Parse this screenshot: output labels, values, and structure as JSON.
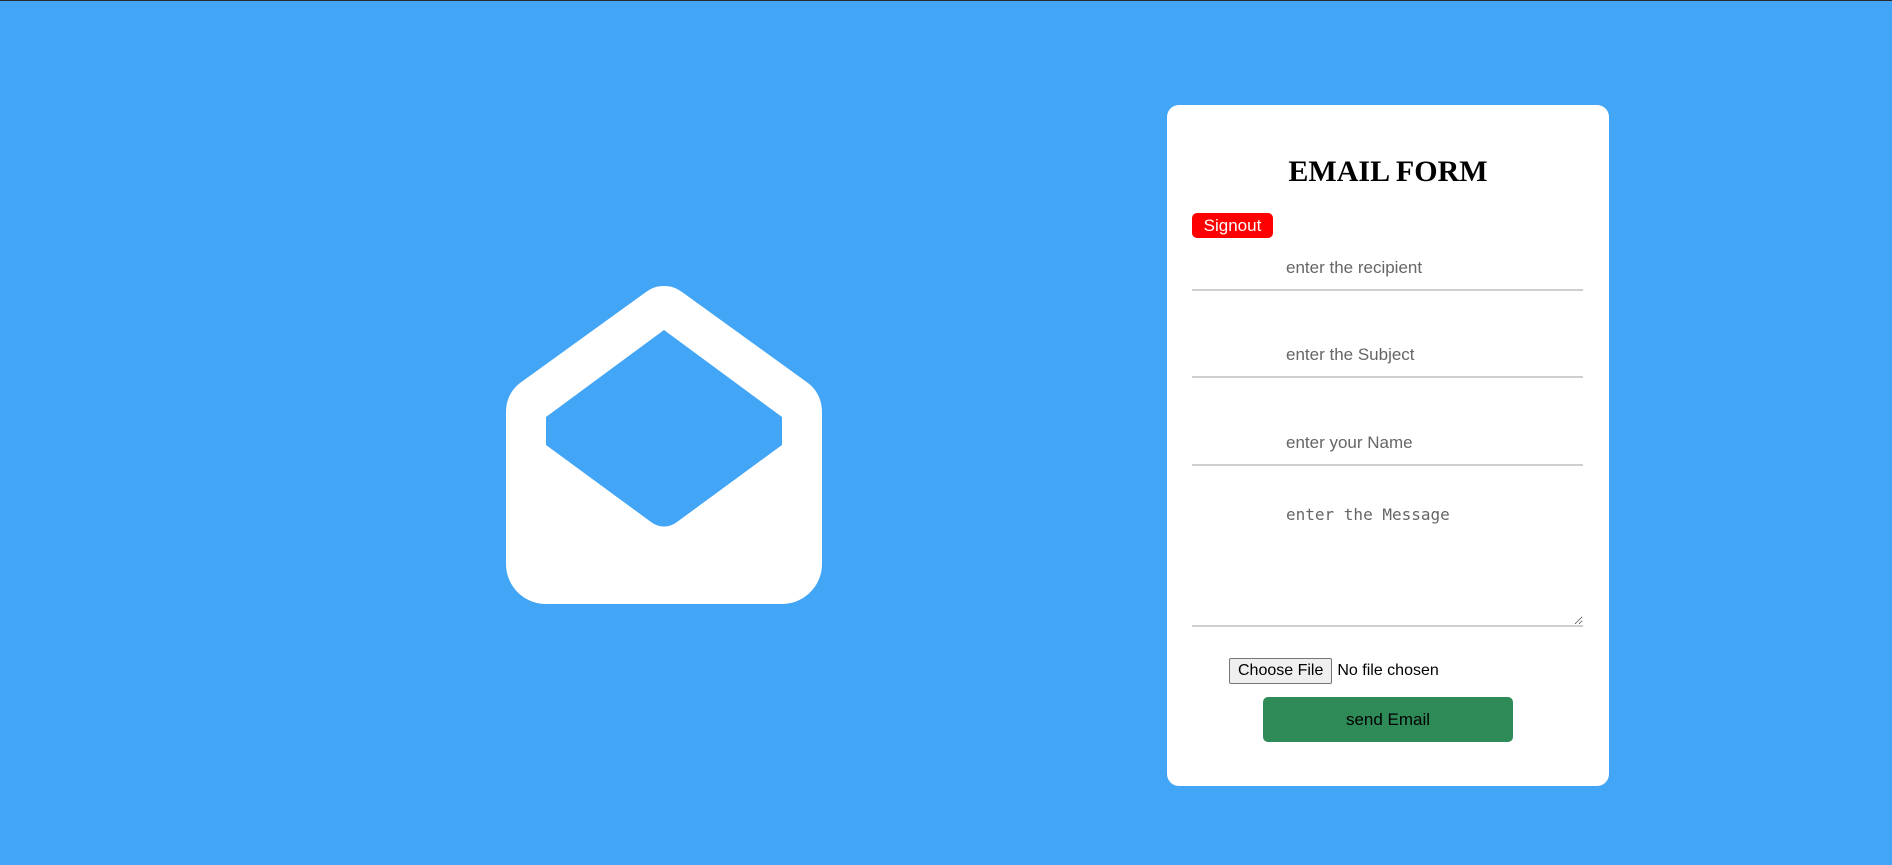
{
  "hero": {
    "icon": "envelope-open-icon",
    "icon_color": "#ffffff",
    "background_color": "#42a5f5"
  },
  "form": {
    "title": "EMAIL FORM",
    "signout_label": "Signout",
    "signout_color": "#ff0000",
    "recipient_placeholder": "enter the recipient",
    "recipient_value": "",
    "subject_placeholder": "enter the Subject",
    "subject_value": "",
    "name_placeholder": "enter your Name",
    "name_value": "",
    "message_placeholder": "enter the Message",
    "message_value": "",
    "file_button_label": "Choose File",
    "file_status": "No file chosen",
    "send_label": "send Email",
    "send_color": "#2e8b57"
  }
}
